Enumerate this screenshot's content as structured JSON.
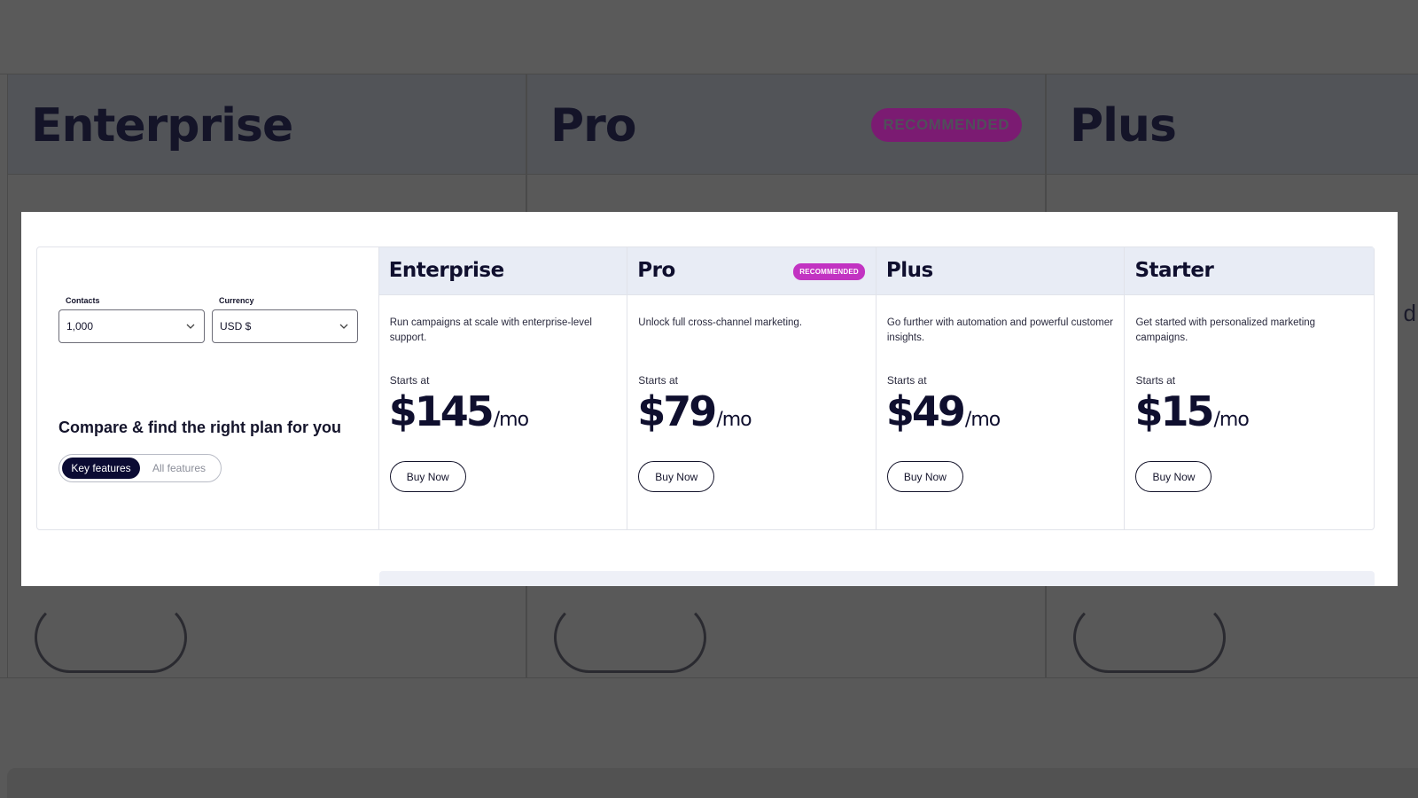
{
  "background": {
    "columns": [
      {
        "title": "Enterprise",
        "badge": ""
      },
      {
        "title": "Pro",
        "badge": "RECOMMENDED"
      },
      {
        "title": "Plus",
        "badge": ""
      }
    ],
    "peek_letter": "d"
  },
  "filters": {
    "contacts_label": "Contacts",
    "contacts_value": "1,000",
    "currency_label": "Currency",
    "currency_value": "USD $"
  },
  "compare": {
    "title": "Compare & find the right plan for you",
    "toggle_active": "Key features",
    "toggle_inactive": "All features"
  },
  "plans": [
    {
      "name": "Enterprise",
      "badge": "",
      "description": "Run campaigns at scale with enterprise-level support.",
      "starts_label": "Starts at",
      "price": "$145",
      "period": "/mo",
      "cta": "Buy Now"
    },
    {
      "name": "Pro",
      "badge": "RECOMMENDED",
      "description": "Unlock full cross-channel marketing.",
      "starts_label": "Starts at",
      "price": "$79",
      "period": "/mo",
      "cta": "Buy Now"
    },
    {
      "name": "Plus",
      "badge": "",
      "description": "Go further with automation and powerful customer insights.",
      "starts_label": "Starts at",
      "price": "$49",
      "period": "/mo",
      "cta": "Buy Now"
    },
    {
      "name": "Starter",
      "badge": "",
      "description": "Get started with personalized marketing campaigns.",
      "starts_label": "Starts at",
      "price": "$15",
      "period": "/mo",
      "cta": "Buy Now"
    }
  ],
  "colors": {
    "overlay": "#595959",
    "header_band": "#e8ecf5",
    "badge": "#c233c2",
    "ink": "#0f0f2e"
  }
}
